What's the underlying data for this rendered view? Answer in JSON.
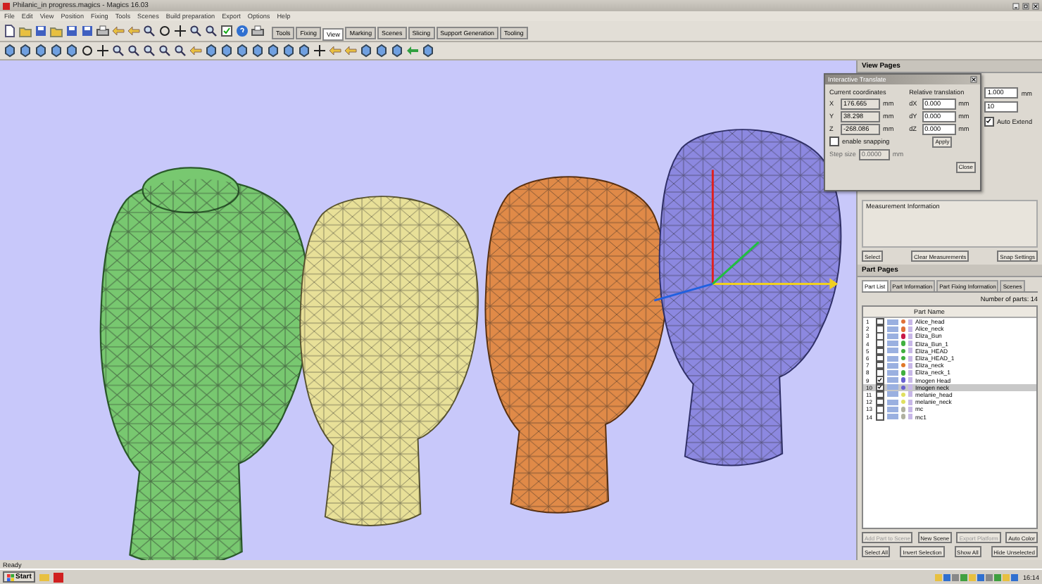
{
  "window": {
    "title": "Philanic_in progress.magics - Magics 16.03"
  },
  "menu": [
    "File",
    "Edit",
    "View",
    "Position",
    "Fixing",
    "Tools",
    "Scenes",
    "Build preparation",
    "Export",
    "Options",
    "Help"
  ],
  "toolbar_tabs": [
    {
      "label": "Tools",
      "selected": false
    },
    {
      "label": "Fixing",
      "selected": false
    },
    {
      "label": "View",
      "selected": true
    },
    {
      "label": "Marking",
      "selected": false
    },
    {
      "label": "Scenes",
      "selected": false
    },
    {
      "label": "Slicing",
      "selected": false
    },
    {
      "label": "Support Generation",
      "selected": false
    },
    {
      "label": "Tooling",
      "selected": false
    }
  ],
  "view_pages": {
    "title": "View Pages",
    "fields": [
      {
        "value": "1.000",
        "unit": "mm"
      },
      {
        "value": "10"
      }
    ],
    "auto_extend": {
      "label": "Auto Extend",
      "checked": true
    },
    "group": "Measurement Information",
    "buttons": [
      "Select",
      "Clear Measurements",
      "Snap Settings"
    ]
  },
  "dialog": {
    "title": "Interactive Translate",
    "current_label": "Current coordinates",
    "relative_label": "Relative translation",
    "coords": [
      {
        "axis": "X",
        "value": "176.665",
        "unit": "mm"
      },
      {
        "axis": "Y",
        "value": "38.298",
        "unit": "mm"
      },
      {
        "axis": "Z",
        "value": "-268.086",
        "unit": "mm"
      }
    ],
    "relative": [
      {
        "axis": "dX",
        "value": "0.000",
        "unit": "mm"
      },
      {
        "axis": "dY",
        "value": "0.000",
        "unit": "mm"
      },
      {
        "axis": "dZ",
        "value": "0.000",
        "unit": "mm"
      }
    ],
    "apply": "Apply",
    "snapping": {
      "label": "enable snapping",
      "checked": false
    },
    "step": {
      "label": "Step size",
      "value": "0.0000",
      "unit": "mm",
      "disabled": true
    },
    "close": "Close"
  },
  "part_pages": {
    "title": "Part Pages",
    "tabs": [
      {
        "label": "Part List",
        "selected": true
      },
      {
        "label": "Part Information",
        "selected": false
      },
      {
        "label": "Part Fixing Information",
        "selected": false
      },
      {
        "label": "Scenes",
        "selected": false
      }
    ],
    "count": "Number of parts: 14",
    "column": "Part Name",
    "rows": [
      {
        "index": "1",
        "name": "Alice_head",
        "checked": false,
        "selected": false,
        "color": "#e07038"
      },
      {
        "index": "2",
        "name": "Alice_neck",
        "checked": false,
        "selected": false,
        "color": "#e07038"
      },
      {
        "index": "3",
        "name": "Eliza_Bun",
        "checked": false,
        "selected": false,
        "color": "#c81848"
      },
      {
        "index": "4",
        "name": "Eliza_Bun_1",
        "checked": false,
        "selected": false,
        "color": "#40b040"
      },
      {
        "index": "5",
        "name": "Eliza_HEAD",
        "checked": false,
        "selected": false,
        "color": "#40b040"
      },
      {
        "index": "6",
        "name": "Eliza_HEAD_1",
        "checked": false,
        "selected": false,
        "color": "#40b040"
      },
      {
        "index": "7",
        "name": "Eliza_neck",
        "checked": false,
        "selected": false,
        "color": "#e07828"
      },
      {
        "index": "8",
        "name": "Eliza_neck_1",
        "checked": false,
        "selected": false,
        "color": "#40b040"
      },
      {
        "index": "9",
        "name": "Imogen Head",
        "checked": true,
        "selected": false,
        "color": "#6860d0"
      },
      {
        "index": "10",
        "name": "Imogen neck",
        "checked": true,
        "selected": true,
        "color": "#6860d0"
      },
      {
        "index": "11",
        "name": "melanie_head",
        "checked": false,
        "selected": false,
        "color": "#e0e060"
      },
      {
        "index": "12",
        "name": "melanie_neck",
        "checked": false,
        "selected": false,
        "color": "#e0e060"
      },
      {
        "index": "13",
        "name": "mc",
        "checked": false,
        "selected": false,
        "color": "#b0b0a0"
      },
      {
        "index": "14",
        "name": "mc1",
        "checked": false,
        "selected": false,
        "color": "#b0b0a0"
      }
    ],
    "buttons": [
      {
        "label": "Add Part to Scene",
        "disabled": true
      },
      {
        "label": "New Scene",
        "disabled": false
      },
      {
        "label": "Export Platform",
        "disabled": true
      },
      {
        "label": "Auto Color",
        "disabled": false
      },
      {
        "label": "Select All",
        "disabled": false
      },
      {
        "label": "Invert Selection",
        "disabled": false
      },
      {
        "label": "Show All",
        "disabled": false
      },
      {
        "label": "Hide Unselected",
        "disabled": false
      }
    ]
  },
  "status_bar": "Ready",
  "taskbar": {
    "start": "Start",
    "clock": "16:14"
  }
}
